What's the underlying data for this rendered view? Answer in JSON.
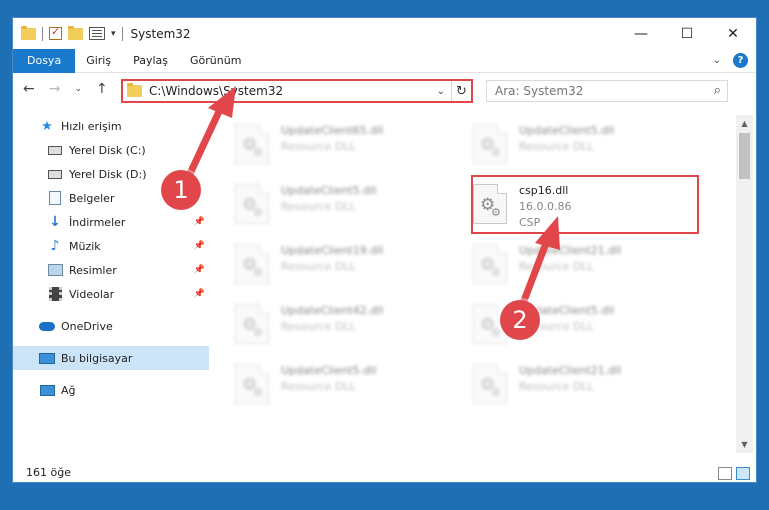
{
  "window": {
    "title": "System32"
  },
  "window_controls": {
    "minimize": "—",
    "maximize": "☐",
    "close": "✕"
  },
  "ribbon": {
    "tabs": [
      "Dosya",
      "Giriş",
      "Paylaş",
      "Görünüm"
    ],
    "help": "?"
  },
  "address": {
    "path": "C:\\Windows\\System32"
  },
  "search": {
    "placeholder": "Ara: System32"
  },
  "sidebar": {
    "quick_access": "Hızlı erişim",
    "items": [
      "Yerel Disk (C:)",
      "Yerel Disk (D:)",
      "Belgeler",
      "İndirmeler",
      "Müzik",
      "Resimler",
      "Videolar"
    ],
    "onedrive": "OneDrive",
    "this_pc": "Bu bilgisayar",
    "network": "Ağ"
  },
  "files": {
    "left": [
      {
        "name": "UpdateClient65.dll",
        "desc": "Resource DLL"
      },
      {
        "name": "UpdateClient5.dll",
        "desc": "Resource DLL"
      },
      {
        "name": "UpdateClient19.dll",
        "desc": "Resource DLL"
      },
      {
        "name": "UpdateClient42.dll",
        "desc": "Resource DLL"
      },
      {
        "name": "UpdateClient5.dll",
        "desc": "Resource DLL"
      }
    ],
    "right_top": {
      "name": "UpdateClient5.dll",
      "desc": "Resource DLL"
    },
    "highlighted": {
      "name": "csp16.dll",
      "version": "16.0.0.86",
      "company": "CSP"
    },
    "right": [
      {
        "name": "UpdateClient21.dll",
        "desc": "Resource DLL"
      },
      {
        "name": "UpdateClient5.dll",
        "desc": "Resource DLL"
      },
      {
        "name": "UpdateClient21.dll",
        "desc": "Resource DLL"
      }
    ]
  },
  "status": {
    "count": "161 öğe"
  },
  "annotations": {
    "marker1": "1",
    "marker2": "2",
    "color": "#e0464a"
  }
}
